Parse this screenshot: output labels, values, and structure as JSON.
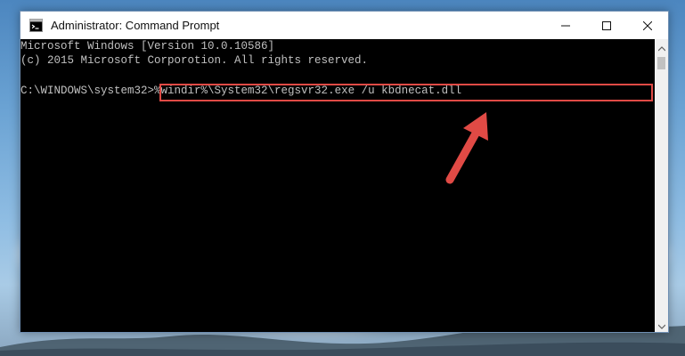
{
  "window": {
    "title": "Administrator: Command Prompt"
  },
  "console": {
    "lines": [
      "Microsoft Windows [Version 10.0.10586]",
      "(c) 2015 Microsoft Corporotion. All rights reserved.",
      "",
      "C:\\WINDOWS\\system32>%windir%\\System32\\regsvr32.exe /u kbdnecat.dll"
    ],
    "prompt": "C:\\WINDOWS\\system32>",
    "command": "%windir%\\System32\\regsvr32.exe /u kbdnecat.dll"
  },
  "icons": {
    "titlebar": "cmd-icon",
    "minimize": "minimize-icon",
    "maximize": "maximize-icon",
    "close": "close-icon",
    "scroll_up": "chevron-up-icon",
    "scroll_down": "chevron-down-icon"
  },
  "colors": {
    "console_text": "#c0c0c0",
    "console_bg": "#000000",
    "highlight": "#e04a45",
    "annotation_arrow": "#e04a45"
  }
}
